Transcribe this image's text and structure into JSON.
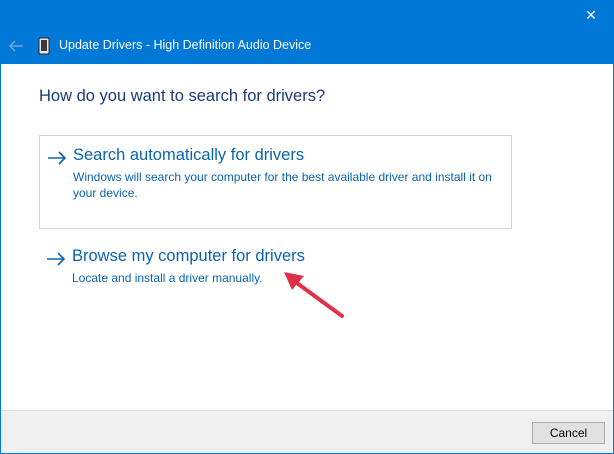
{
  "window": {
    "title": "Update Drivers - High Definition Audio Device",
    "close_glyph": "✕"
  },
  "main": {
    "question": "How do you want to search for drivers?",
    "options": [
      {
        "title": "Search automatically for drivers",
        "description": "Windows will search your computer for the best available driver and install it on your device."
      },
      {
        "title": "Browse my computer for drivers",
        "description": "Locate and install a driver manually."
      }
    ]
  },
  "footer": {
    "cancel_label": "Cancel"
  },
  "colors": {
    "titlebar": "#0078d7",
    "link": "#0b63b0",
    "annotation_arrow": "#e0314b"
  },
  "icons": [
    "close-icon",
    "back-arrow-icon",
    "device-icon",
    "right-arrow-icon",
    "annotation-arrow-icon"
  ]
}
